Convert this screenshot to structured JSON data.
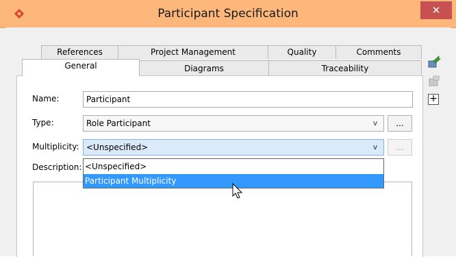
{
  "window": {
    "title": "Participant Specification",
    "close_glyph": "✕",
    "colors": {
      "titlebar": "#fdb77a",
      "close": "#c75050",
      "selection": "#3399ff",
      "focus": "#dbeafa"
    }
  },
  "tabs": {
    "row1": [
      "References",
      "Project Management",
      "Quality",
      "Comments"
    ],
    "row2": [
      "General",
      "Diagrams",
      "Traceability"
    ],
    "active": "General"
  },
  "form": {
    "name_label": "Name:",
    "name_value": "Participant",
    "type_label": "Type:",
    "type_value": "Role Participant",
    "multiplicity_label": "Multiplicity:",
    "multiplicity_value": "<Unspecified>",
    "description_label": "Description:",
    "dots_label": "...",
    "chevron_glyph": "v"
  },
  "dropdown": {
    "options": [
      "<Unspecified>",
      "Participant Multiplicity"
    ],
    "highlighted_index": 1
  },
  "side_toolbar": {
    "icons": [
      "green-arrow-icon",
      "disabled-stamp-icon",
      "expand-plus-icon"
    ],
    "plus_glyph": "+"
  }
}
